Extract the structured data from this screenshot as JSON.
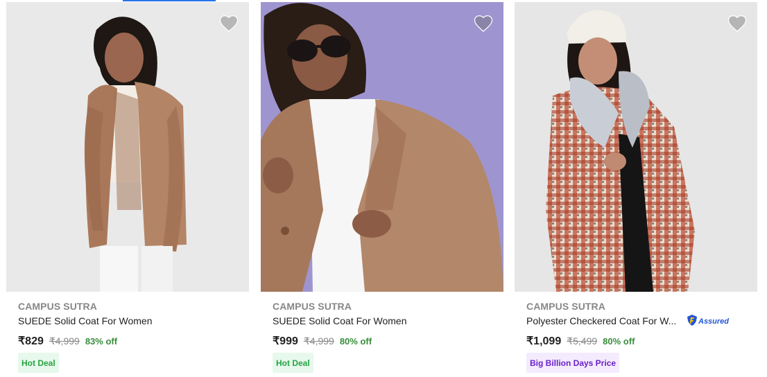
{
  "products": [
    {
      "brand": "CAMPUS SUTRA",
      "title": "SUEDE Solid Coat For Women",
      "price": "₹829",
      "mrp": "₹4,999",
      "discount": "83% off",
      "badge": "Hot Deal",
      "image_desc": "woman-in-tan-suede-blazer-grey-background",
      "wishlist_icon": "heart-icon"
    },
    {
      "brand": "CAMPUS SUTRA",
      "title": "SUEDE Solid Coat For Women",
      "price": "₹999",
      "mrp": "₹4,999",
      "discount": "80% off",
      "badge": "Hot Deal",
      "image_desc": "woman-with-sunglasses-in-brown-suede-blazer-purple-background",
      "wishlist_icon": "heart-icon"
    },
    {
      "brand": "CAMPUS SUTRA",
      "title": "Polyester Checkered Coat For W...",
      "assured_label": "Assured",
      "price": "₹1,099",
      "mrp": "₹5,499",
      "discount": "80% off",
      "badge": "Big Billion Days Price",
      "image_desc": "woman-in-checkered-coat-with-fur-collar-and-beanie",
      "wishlist_icon": "heart-icon"
    }
  ],
  "colors": {
    "accent": "#2874f0",
    "discount": "#388e3c",
    "hot_deal_bg": "#e7f8ec",
    "hot_deal_text": "#26a541",
    "bbd_bg": "#f4ebff",
    "bbd_text": "#6a21c9"
  }
}
